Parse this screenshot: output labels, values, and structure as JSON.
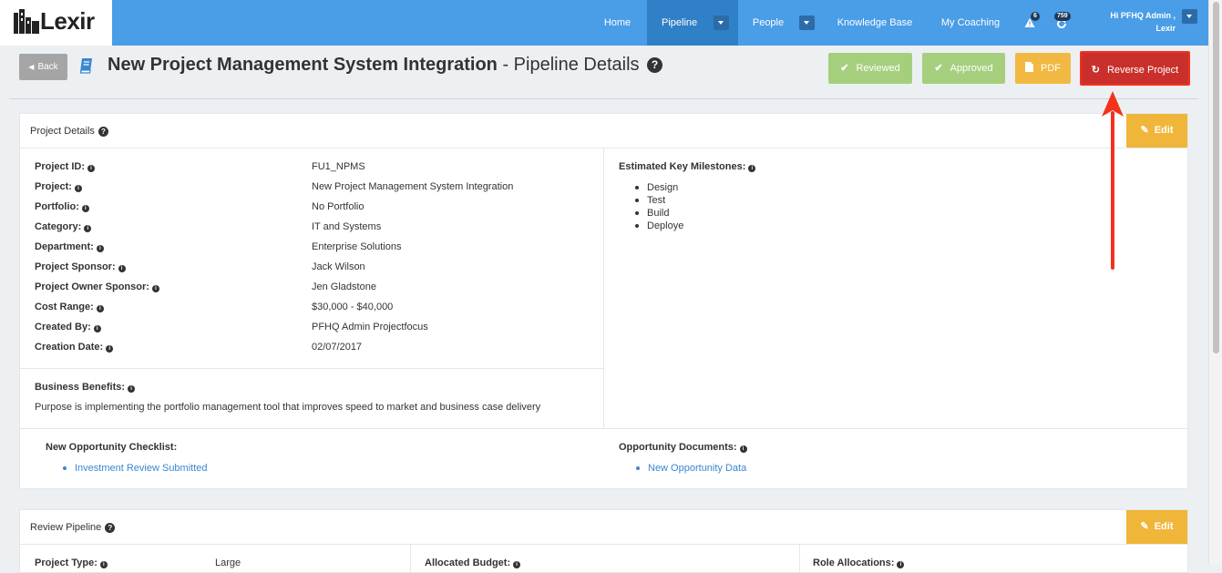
{
  "brand": {
    "logo_text": "Lexir"
  },
  "nav": {
    "items": [
      "Home",
      "Pipeline",
      "People",
      "Knowledge Base",
      "My Coaching"
    ],
    "alerts_count": "6",
    "updates_count": "759",
    "greeting_line1": "Hi PFHQ Admin ,",
    "greeting_line2": "Lexir"
  },
  "header": {
    "back_label": "Back",
    "title_bold": "New Project Management System Integration",
    "title_rest": " - Pipeline Details",
    "help_glyph": "?",
    "buttons": {
      "reviewed": "Reviewed",
      "approved": "Approved",
      "pdf": "PDF",
      "reverse": "Reverse Project"
    }
  },
  "project_details": {
    "title": "Project Details",
    "edit_label": "Edit",
    "fields": [
      {
        "label": "Project ID:",
        "value": "FU1_NPMS"
      },
      {
        "label": "Project:",
        "value": "New Project Management System Integration"
      },
      {
        "label": "Portfolio:",
        "value": "No Portfolio"
      },
      {
        "label": "Category:",
        "value": "IT and Systems"
      },
      {
        "label": "Department:",
        "value": "Enterprise Solutions"
      },
      {
        "label": "Project Sponsor:",
        "value": "Jack Wilson"
      },
      {
        "label": "Project Owner Sponsor:",
        "value": "Jen Gladstone"
      },
      {
        "label": "Cost Range:",
        "value": "$30,000 - $40,000"
      },
      {
        "label": "Created By:",
        "value": "PFHQ Admin Projectfocus"
      },
      {
        "label": "Creation Date:",
        "value": "02/07/2017"
      }
    ],
    "milestones_label": "Estimated Key Milestones:",
    "milestones": [
      "Design",
      "Test",
      "Build",
      "Deploye"
    ],
    "benefits_label": "Business Benefits:",
    "benefits_text": "Purpose is implementing the portfolio management tool that improves speed to market and business case delivery",
    "checklist_label": "New Opportunity Checklist:",
    "checklist_items": [
      "Investment Review Submitted"
    ],
    "documents_label": "Opportunity Documents:",
    "documents_items": [
      "New Opportunity Data"
    ]
  },
  "review_pipeline": {
    "title": "Review Pipeline",
    "edit_label": "Edit",
    "project_type_label": "Project Type:",
    "project_type_value": "Large",
    "budget_label": "Allocated Budget:",
    "roles_label": "Role Allocations:"
  },
  "colors": {
    "nav": "#4a9de7",
    "reviewed": "#a6cf7d",
    "approved": "#a6cf7d",
    "pdf": "#f2b942",
    "reverse": "#c9302c",
    "edit": "#f0b63a",
    "link": "#3a87cf",
    "annotation_arrow": "#f3321c"
  }
}
